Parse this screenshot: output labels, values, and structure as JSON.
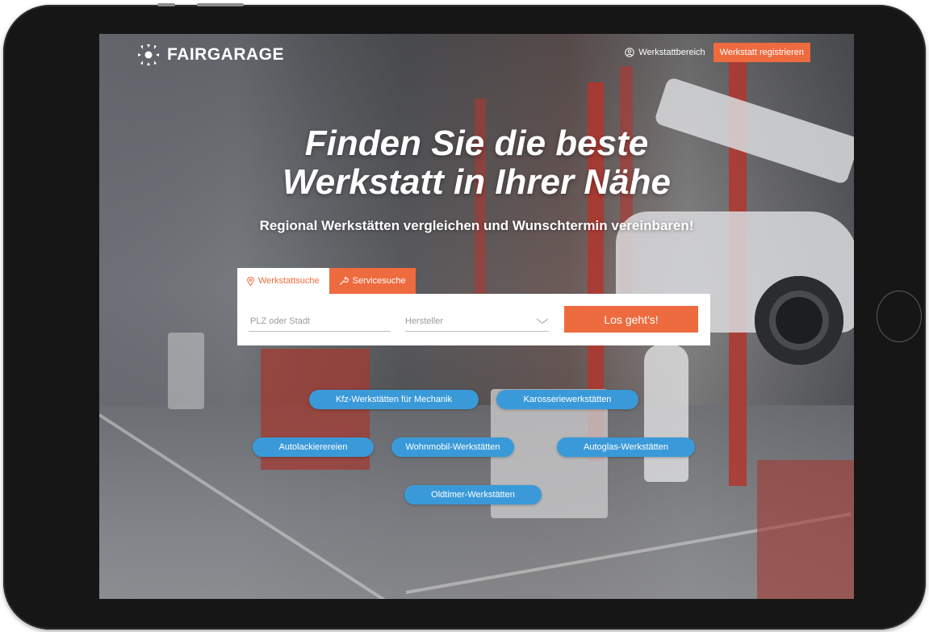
{
  "brand": {
    "name": "FAIRGARAGE"
  },
  "header": {
    "werkstattbereich_label": "Werkstattbereich",
    "register_label": "Werkstatt registrieren"
  },
  "hero": {
    "title_line1": "Finden Sie die beste",
    "title_line2": "Werkstatt in Ihrer Nähe",
    "subtitle": "Regional Werkstätten vergleichen und Wunschtermin vereinbaren!"
  },
  "search": {
    "tabs": [
      {
        "label": "Werkstattsuche",
        "icon": "location-pin-icon",
        "active": true
      },
      {
        "label": "Servicesuche",
        "icon": "wrench-icon",
        "active": false
      }
    ],
    "location_placeholder": "PLZ oder Stadt",
    "manufacturer_placeholder": "Hersteller",
    "submit_label": "Los geht's!"
  },
  "categories": [
    "Kfz-Werkstätten für Mechanik",
    "Karosseriewerkstätten",
    "Autolackierereien",
    "Wohnmobil-Werkstätten",
    "Autoglas-Werkstätten",
    "Oldtimer-Werkstätten"
  ],
  "colors": {
    "accent": "#ee6b3f",
    "pill": "#3a9ad9",
    "device": "#161616"
  }
}
